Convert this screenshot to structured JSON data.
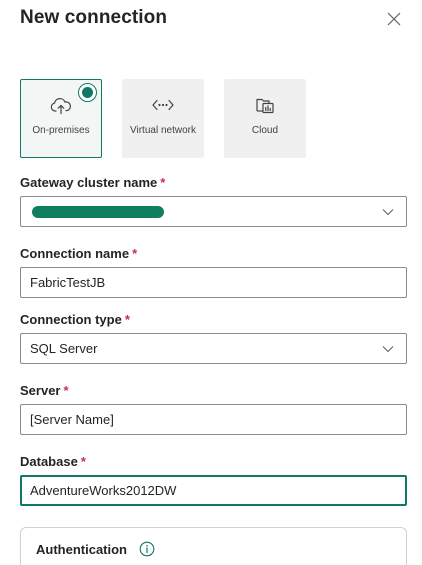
{
  "panel": {
    "title": "New connection"
  },
  "tiles": [
    {
      "label": "On-premises",
      "selected": true,
      "icon": "cloud-upload-icon"
    },
    {
      "label": "Virtual network",
      "selected": false,
      "icon": "virtual-network-icon"
    },
    {
      "label": "Cloud",
      "selected": false,
      "icon": "cloud-report-icon"
    }
  ],
  "fields": {
    "gateway_cluster": {
      "label": "Gateway cluster name",
      "required": "*",
      "value": ""
    },
    "connection_name": {
      "label": "Connection name",
      "required": "*",
      "value": "FabricTestJB"
    },
    "connection_type": {
      "label": "Connection type",
      "required": "*",
      "value": "SQL Server"
    },
    "server": {
      "label": "Server",
      "required": "*",
      "value": "[Server Name]"
    },
    "database": {
      "label": "Database",
      "required": "*",
      "value": "AdventureWorks2012DW"
    }
  },
  "authentication": {
    "title": "Authentication",
    "icon": "info-icon"
  },
  "colors": {
    "accent": "#117865",
    "required": "#c4314b",
    "redaction": "#0f7f5d"
  }
}
